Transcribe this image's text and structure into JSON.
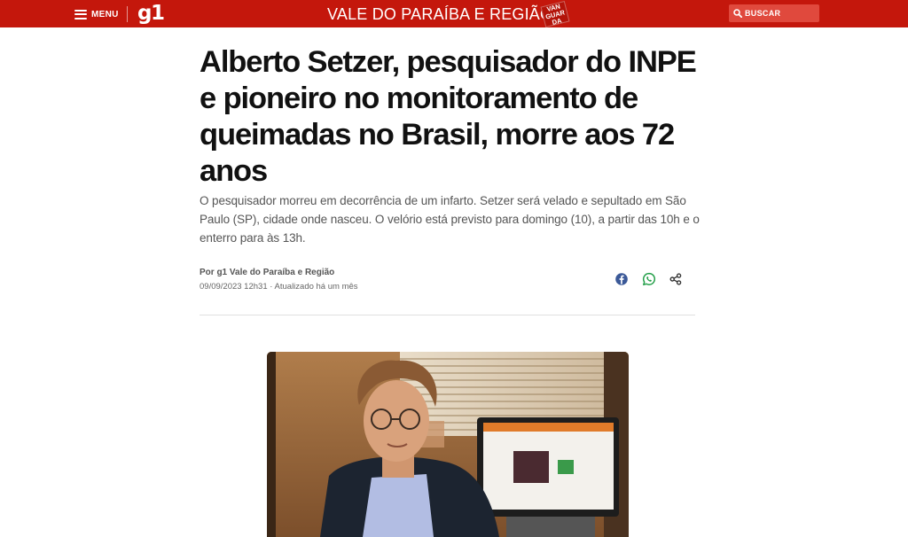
{
  "header": {
    "menu_label": "MENU",
    "logo_text": "g1",
    "region_title": "VALE DO PARAÍBA E REGIÃO",
    "badge_text": [
      "VAN",
      "GUAR",
      "DA"
    ],
    "search_label": "BUSCAR",
    "accent_color": "#c4170c"
  },
  "article": {
    "title": "Alberto Setzer, pesquisador do INPE e pioneiro no monitoramento de queimadas no Brasil, morre aos 72 anos",
    "subtitle": "O pesquisador morreu em decorrência de um infarto. Setzer será velado e sepultado em São Paulo (SP), cidade onde nasceu. O velório está previsto para domingo (10), a partir das 10h e o enterro para às 13h.",
    "byline": "Por g1 Vale do Paraíba e Região",
    "date": "09/09/2023 12h31 · Atualizado há um mês"
  },
  "share": {
    "icons": [
      "facebook-icon",
      "whatsapp-icon",
      "share-icon"
    ],
    "facebook_color": "#3b5998",
    "whatsapp_color": "#25a04a"
  }
}
